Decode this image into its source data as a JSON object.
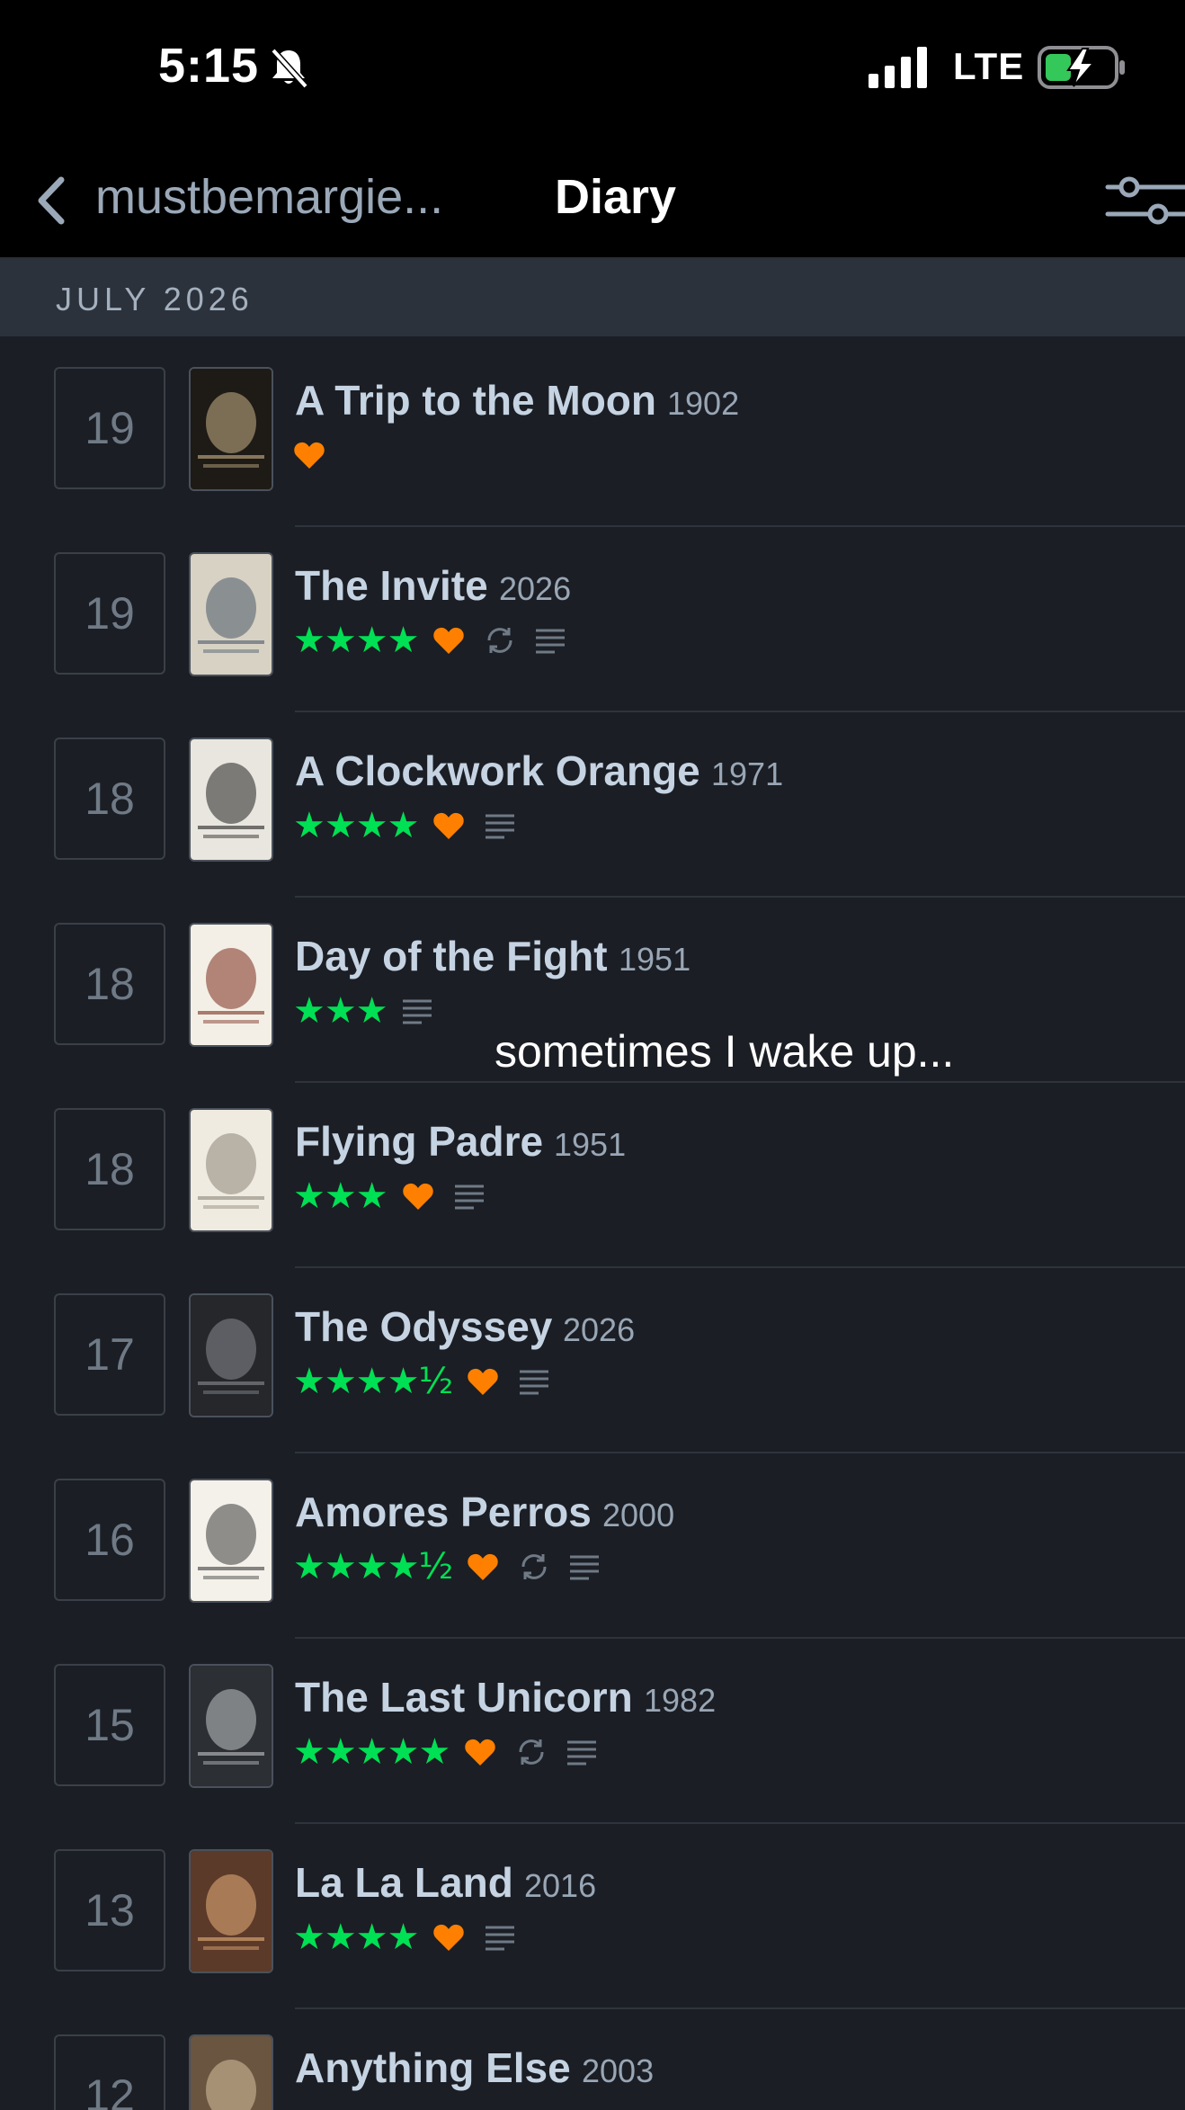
{
  "status_bar": {
    "time": "5:15",
    "network": "LTE"
  },
  "nav": {
    "back_label": "mustbemargie...",
    "title": "Diary"
  },
  "month_header": "JULY 2026",
  "overlay_caption": "sometimes I wake up...",
  "colors": {
    "stars": "#00e054",
    "like": "#ff8000",
    "text": "#c5d3e2",
    "background": "#1b1e24"
  },
  "entries": [
    {
      "day": "19",
      "title": "A Trip to the Moon",
      "year": "1902",
      "stars": "",
      "liked": true,
      "rewatch": false,
      "review": false,
      "poster_text": "A Trip to the Moon"
    },
    {
      "day": "19",
      "title": "The Invite",
      "year": "2026",
      "stars": "★★★★",
      "liked": true,
      "rewatch": true,
      "review": true,
      "poster_text": "The Invite."
    },
    {
      "day": "18",
      "title": "A Clockwork Orange",
      "year": "1971",
      "stars": "★★★★",
      "liked": true,
      "rewatch": false,
      "review": true,
      "poster_text": "a clockwork orange"
    },
    {
      "day": "18",
      "title": "Day of the Fight",
      "year": "1951",
      "stars": "★★★",
      "liked": false,
      "rewatch": false,
      "review": true,
      "poster_text": "DAY OF THE FIGHT"
    },
    {
      "day": "18",
      "title": "Flying Padre",
      "year": "1951",
      "stars": "★★★",
      "liked": true,
      "rewatch": false,
      "review": true,
      "poster_text": "FLYING PADRE"
    },
    {
      "day": "17",
      "title": "The Odyssey",
      "year": "2026",
      "stars": "★★★★½",
      "liked": true,
      "rewatch": false,
      "review": true,
      "poster_text": ""
    },
    {
      "day": "16",
      "title": "Amores Perros",
      "year": "2000",
      "stars": "★★★★½",
      "liked": true,
      "rewatch": true,
      "review": true,
      "poster_text": "AMORES PERROS"
    },
    {
      "day": "15",
      "title": "The Last Unicorn",
      "year": "1982",
      "stars": "★★★★★",
      "liked": true,
      "rewatch": true,
      "review": true,
      "poster_text": "The Last Unicorn"
    },
    {
      "day": "13",
      "title": "La La Land",
      "year": "2016",
      "stars": "★★★★",
      "liked": true,
      "rewatch": false,
      "review": true,
      "poster_text": "LA LA LAND"
    },
    {
      "day": "12",
      "title": "Anything Else",
      "year": "2003",
      "stars": "",
      "liked": false,
      "rewatch": false,
      "review": false,
      "poster_text": ""
    }
  ]
}
